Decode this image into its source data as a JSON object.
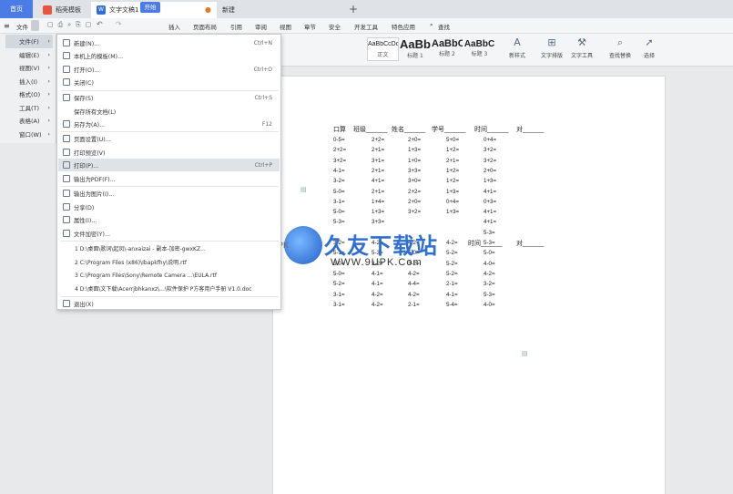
{
  "tabs": {
    "home": "首页",
    "templates": "稻壳模板",
    "document": "文字文稿1",
    "new": "新建",
    "add": "+"
  },
  "menubar": {
    "file": "文件",
    "items": [
      "开始",
      "插入",
      "页面布局",
      "引用",
      "审阅",
      "视图",
      "章节",
      "安全",
      "开发工具",
      "特色应用"
    ],
    "search": "查找"
  },
  "ribbon": {
    "styles": [
      {
        "sample": "AaBbCcDd",
        "label": "正文"
      },
      {
        "sample": "AaBb",
        "label": "标题 1"
      },
      {
        "sample": "AaBbC",
        "label": "标题 2"
      },
      {
        "sample": "AaBbC",
        "label": "标题 3"
      }
    ],
    "buttons": [
      "新样式",
      "文字排版",
      "文字工具",
      "查找替换",
      "选择"
    ]
  },
  "mainmenu": [
    {
      "label": "文件(F)",
      "active": true
    },
    {
      "label": "编辑(E)"
    },
    {
      "label": "视图(V)"
    },
    {
      "label": "插入(I)"
    },
    {
      "label": "格式(O)"
    },
    {
      "label": "工具(T)"
    },
    {
      "label": "表格(A)"
    },
    {
      "label": "窗口(W)"
    }
  ],
  "submenu": {
    "items": [
      {
        "label": "新建(N)...",
        "shortcut": "Ctrl+N"
      },
      {
        "label": "本机上的模板(M)...",
        "shortcut": ""
      },
      {
        "label": "打开(O)...",
        "shortcut": "Ctrl+O"
      },
      {
        "label": "关闭(C)",
        "shortcut": ""
      },
      {
        "label": "保存(S)",
        "shortcut": "Ctrl+S"
      },
      {
        "label": "保存所有文档(L)",
        "shortcut": ""
      },
      {
        "label": "另存为(A)...",
        "shortcut": "F12"
      },
      {
        "label": "页面设置(U)...",
        "shortcut": ""
      },
      {
        "label": "打印预览(V)",
        "shortcut": ""
      },
      {
        "label": "打印(P)...",
        "shortcut": "Ctrl+P"
      },
      {
        "label": "输出为PDF(F)...",
        "shortcut": ""
      },
      {
        "label": "输出为图片(I)...",
        "shortcut": ""
      },
      {
        "label": "分享(D)",
        "shortcut": ""
      },
      {
        "label": "属性(I)...",
        "shortcut": ""
      },
      {
        "label": "文件加密(Y)...",
        "shortcut": ""
      }
    ],
    "recent": [
      "1 D:\\桌面\\歌词\\起凤\\-anxaizai - 副本-加密-gwxKZ...",
      "2 C:\\Program Files (x86)\\Ibapkfhy\\说明.rtf",
      "3 C:\\Program Files\\Sony\\Remote Camera ...\\EULA.rtf",
      "4 D:\\桌面\\文下载\\Acerrjbhkanxz\\...\\软件保护 P方客用户手册 V1.0.doc"
    ],
    "exit": "退出(X)"
  },
  "worksheet": {
    "header1": [
      "口算",
      "班级______",
      "姓名______",
      "学号______",
      "时间______",
      "对______"
    ],
    "header2": [
      "时间______",
      "对______"
    ],
    "col1": [
      "0-5=",
      "2+2=",
      "3+2=",
      "4-1=",
      "3-2=",
      "5-0=",
      "3-1=",
      "5-0=",
      "5-3=",
      "",
      "3-2=",
      "5-1=",
      "5-0=",
      "5-0=",
      "5-2=",
      "3-1=",
      "3-1="
    ],
    "col2": [
      "2+2=",
      "2+1=",
      "3+1=",
      "2+1=",
      "4+1=",
      "2+1=",
      "1+4=",
      "1+3=",
      "3+3=",
      "",
      "4-2=",
      "5-3=",
      "3-2=",
      "4-1=",
      "4-1=",
      "4-2=",
      "4-2="
    ],
    "col3": [
      "2+0=",
      "1+3=",
      "1+0=",
      "3+3=",
      "3+0=",
      "2+2=",
      "2+0=",
      "3+2=",
      "",
      "",
      "4-2=",
      "5-0=",
      "3-2=",
      "4-2=",
      "4-4=",
      "4-2=",
      "2-1="
    ],
    "col4": [
      "5+0=",
      "1+2=",
      "2+1=",
      "1+2=",
      "1+2=",
      "1+3=",
      "0+4=",
      "1+3=",
      "",
      "",
      "4-2=",
      "5-2=",
      "5-2=",
      "5-2=",
      "2-1=",
      "4-1=",
      "5-4="
    ],
    "col5": [
      "0+4=",
      "3+2=",
      "3+2=",
      "2+0=",
      "1+3=",
      "4+1=",
      "0+3=",
      "4+1=",
      "4+1=",
      "5-3=",
      "5-3=",
      "5-0=",
      "4-0=",
      "4-2=",
      "3-2=",
      "5-3=",
      "4-0="
    ],
    "watermark": {
      "cn": "久友下载站",
      "url": "WWW.9UPK.Com",
      "www": "WWW.9UPK"
    }
  }
}
